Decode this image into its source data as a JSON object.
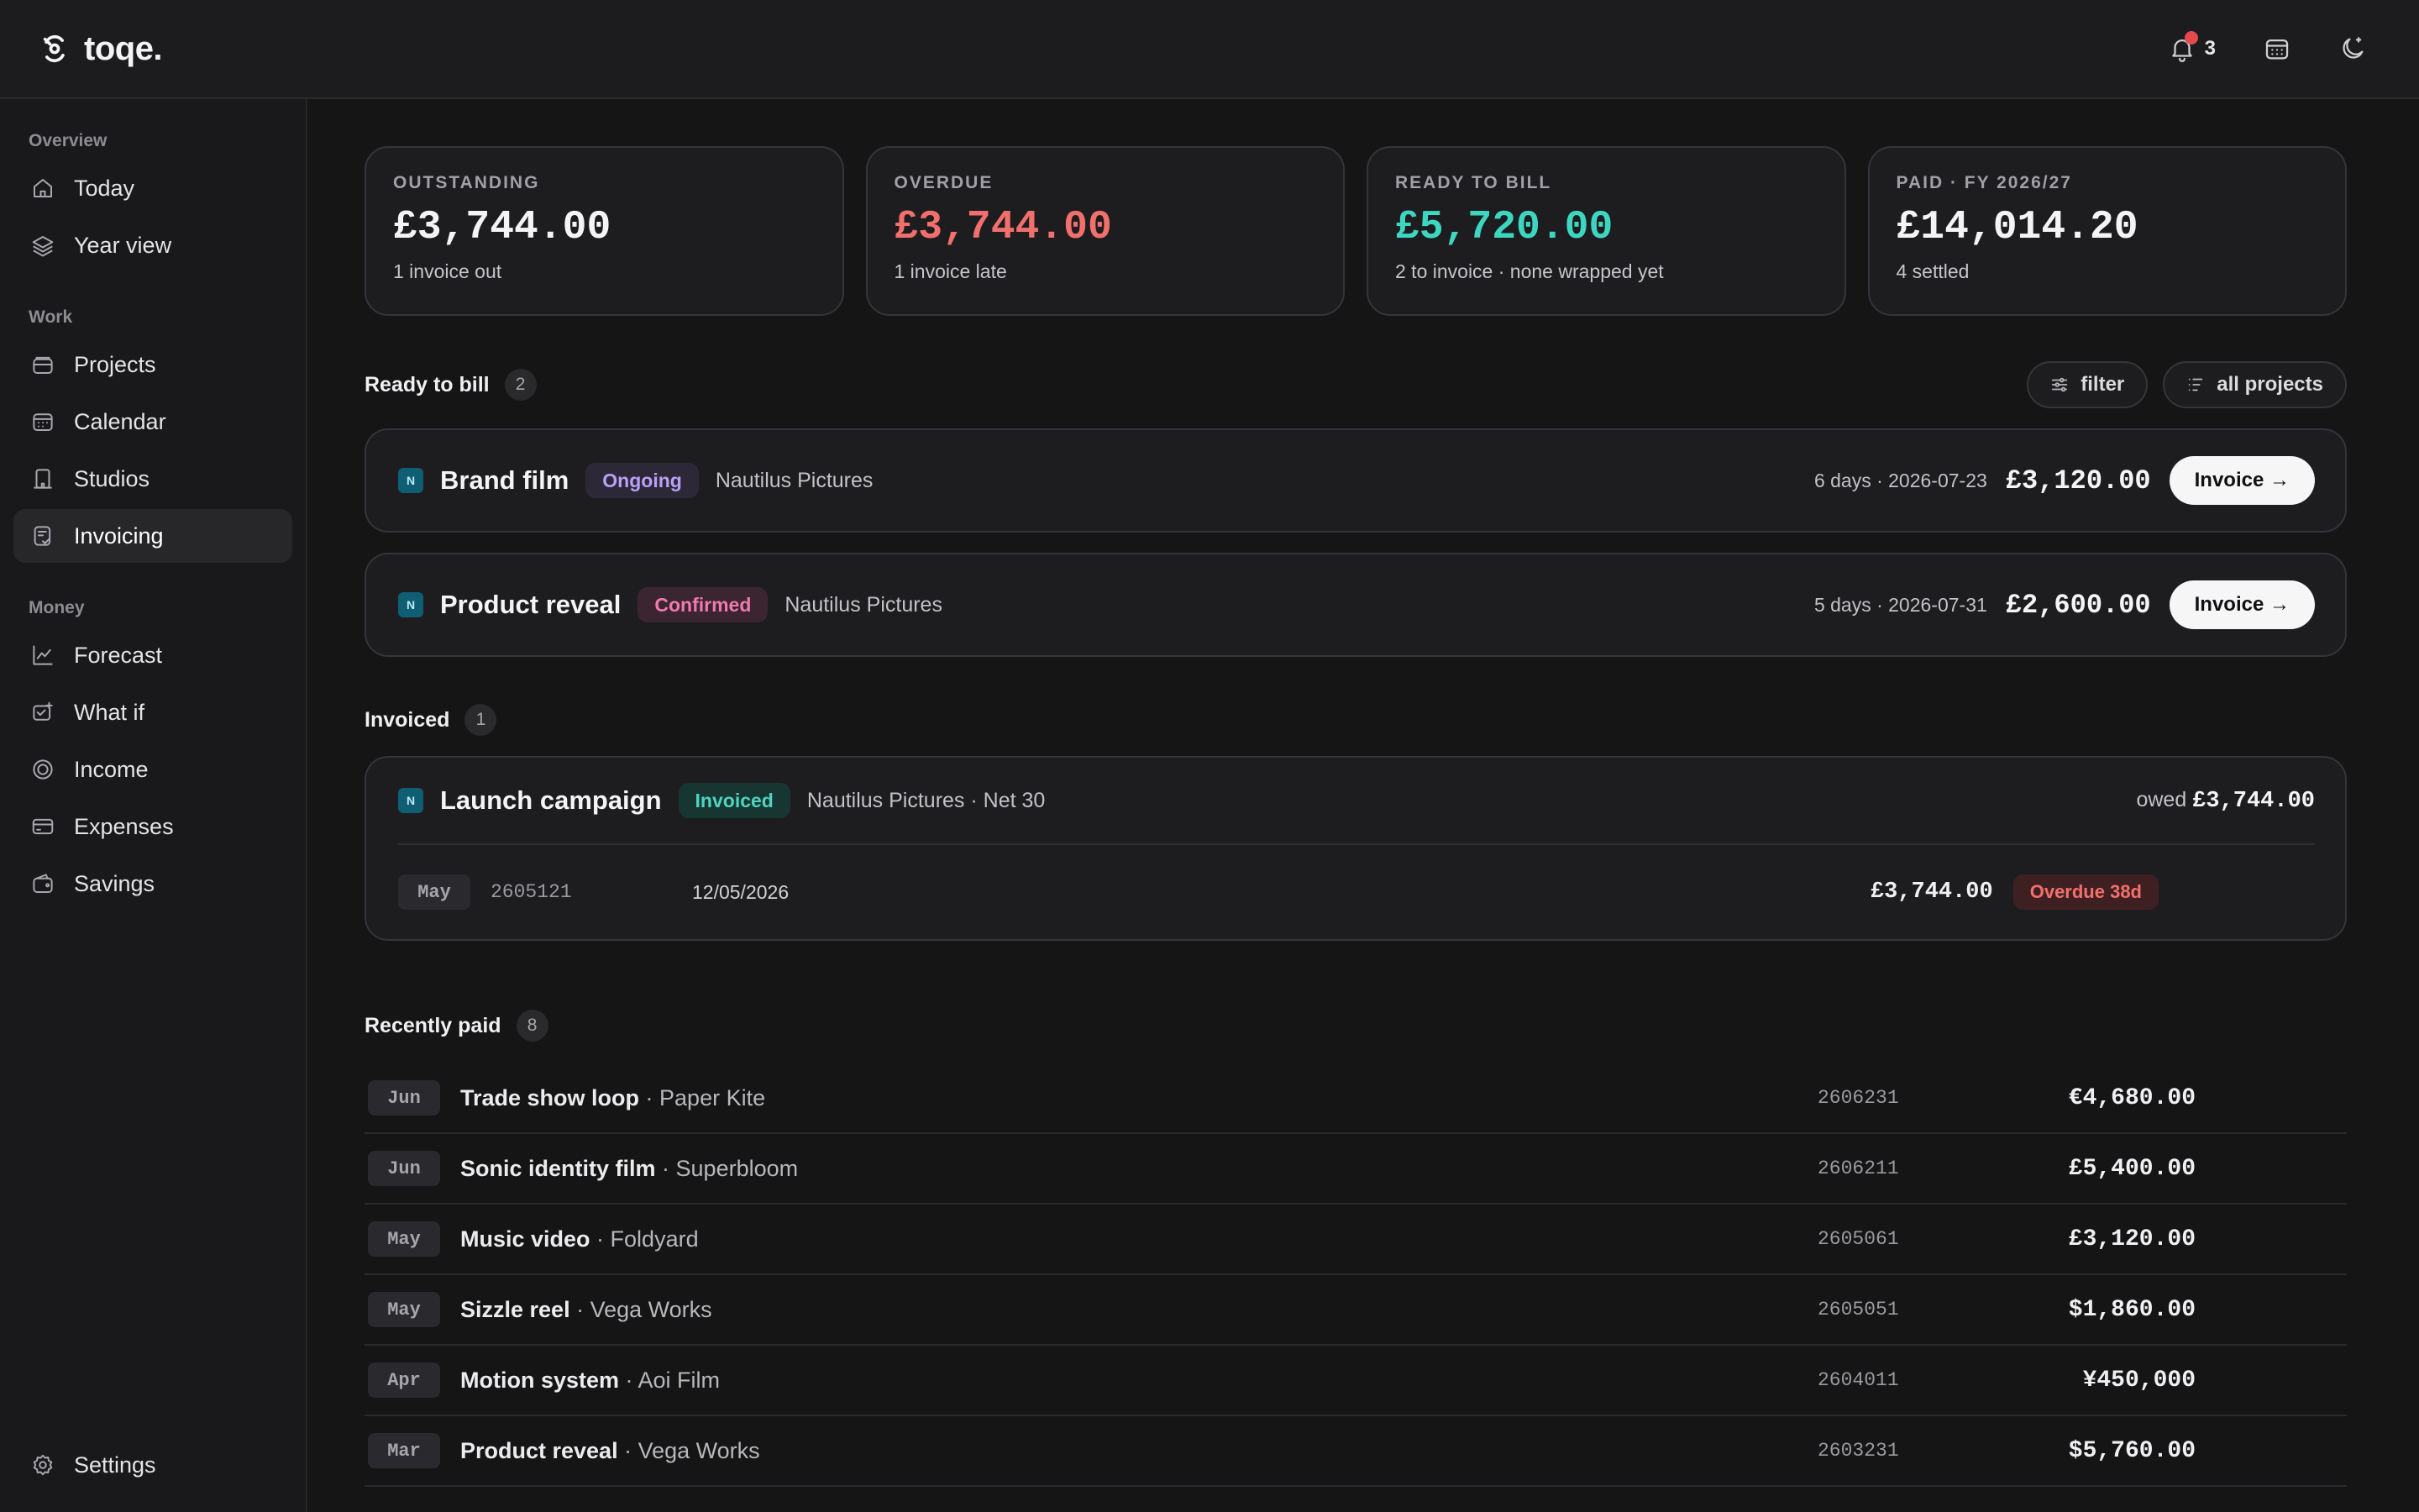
{
  "app": {
    "name": "toqe."
  },
  "topbar": {
    "notification_count": "3"
  },
  "sidebar": {
    "sections": {
      "overview": "Overview",
      "work": "Work",
      "money": "Money"
    },
    "items": {
      "today": "Today",
      "year_view": "Year view",
      "projects": "Projects",
      "calendar": "Calendar",
      "studios": "Studios",
      "invoicing": "Invoicing",
      "forecast": "Forecast",
      "what_if": "What if",
      "income": "Income",
      "expenses": "Expenses",
      "savings": "Savings",
      "settings": "Settings"
    },
    "active": "Invoicing"
  },
  "stats": [
    {
      "label": "OUTSTANDING",
      "value": "£3,744.00",
      "sub": "1 invoice out",
      "color": "#f4f4f5"
    },
    {
      "label": "OVERDUE",
      "value": "£3,744.00",
      "sub": "1 invoice late",
      "color": "#f2706c"
    },
    {
      "label": "READY TO BILL",
      "value": "£5,720.00",
      "sub": "2 to invoice · none wrapped yet",
      "color": "#3dd6c0"
    },
    {
      "label": "PAID · FY 2026/27",
      "value": "£14,014.20",
      "sub": "4 settled",
      "color": "#f4f4f5"
    }
  ],
  "ready_to_bill": {
    "title": "Ready to bill",
    "count": "2",
    "filter_label": "filter",
    "scope_label": "all projects",
    "rows": [
      {
        "badge": "N",
        "name": "Brand film",
        "status": "Ongoing",
        "client": "Nautilus Pictures",
        "due": "6 days · 2026-07-23",
        "amount": "£3,120.00",
        "action": "Invoice →"
      },
      {
        "badge": "N",
        "name": "Product reveal",
        "status": "Confirmed",
        "client": "Nautilus Pictures",
        "due": "5 days · 2026-07-31",
        "amount": "£2,600.00",
        "action": "Invoice →"
      }
    ]
  },
  "invoiced": {
    "title": "Invoiced",
    "count": "1",
    "project": {
      "badge": "N",
      "name": "Launch campaign",
      "status": "Invoiced",
      "client": "Nautilus Pictures · Net 30",
      "owed_label": "owed",
      "owed_amount": "£3,744.00"
    },
    "line": {
      "month": "May",
      "number": "2605121",
      "date": "12/05/2026",
      "amount": "£3,744.00",
      "status": "Overdue 38d"
    }
  },
  "recently_paid": {
    "title": "Recently paid",
    "count": "8",
    "rows": [
      {
        "month": "Jun",
        "title": "Trade show loop",
        "client": " · Paper Kite",
        "number": "2606231",
        "amount": "€4,680.00"
      },
      {
        "month": "Jun",
        "title": "Sonic identity film",
        "client": " · Superbloom",
        "number": "2606211",
        "amount": "£5,400.00"
      },
      {
        "month": "May",
        "title": "Music video",
        "client": " · Foldyard",
        "number": "2605061",
        "amount": "£3,120.00"
      },
      {
        "month": "May",
        "title": "Sizzle reel",
        "client": " · Vega Works",
        "number": "2605051",
        "amount": "$1,860.00"
      },
      {
        "month": "Apr",
        "title": "Motion system",
        "client": " · Aoi Film",
        "number": "2604011",
        "amount": "¥450,000"
      },
      {
        "month": "Mar",
        "title": "Product reveal",
        "client": " · Vega Works",
        "number": "2603231",
        "amount": "$5,760.00"
      }
    ]
  }
}
